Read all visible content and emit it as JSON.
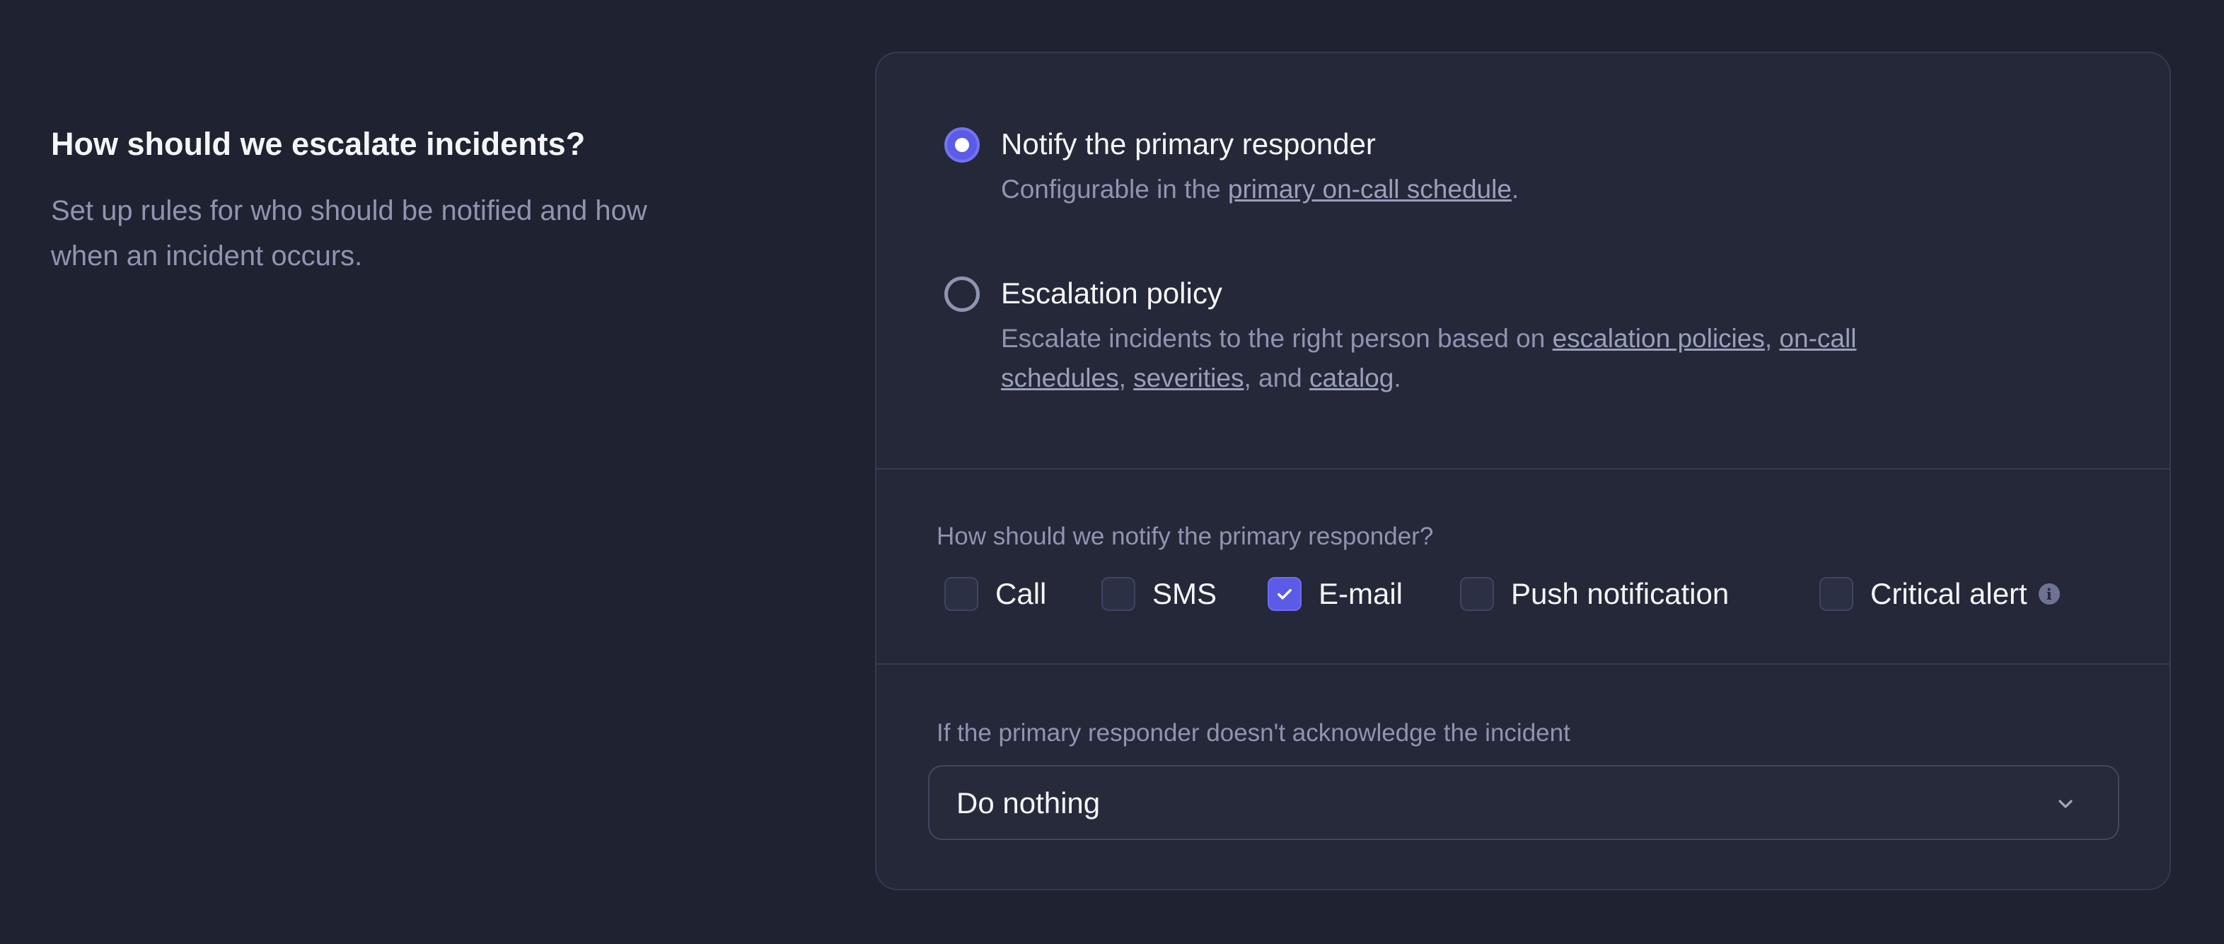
{
  "intro": {
    "title": "How should we escalate incidents?",
    "description": "Set up rules for who should be notified and how when an incident occurs."
  },
  "options": {
    "primary": {
      "title": "Notify the primary responder",
      "selected": true,
      "desc_prefix": "Configurable in the ",
      "link": "primary on-call schedule",
      "desc_suffix": "."
    },
    "escalation": {
      "title": "Escalation policy",
      "selected": false,
      "desc_prefix": "Escalate incidents to the right person based on ",
      "link1": "escalation policies",
      "sep1": ", ",
      "link2": "on-call schedules",
      "sep2": ", ",
      "link3": "severities",
      "sep3": ", and ",
      "link4": "catalog",
      "desc_suffix": "."
    }
  },
  "notify": {
    "label": "How should we notify the primary responder?",
    "methods": [
      {
        "label": "Call",
        "checked": false
      },
      {
        "label": "SMS",
        "checked": false
      },
      {
        "label": "E-mail",
        "checked": true
      },
      {
        "label": "Push notification",
        "checked": false
      },
      {
        "label": "Critical alert",
        "checked": false
      }
    ],
    "info_glyph": "i"
  },
  "no_ack": {
    "label": "If the primary responder doesn't acknowledge the incident",
    "selected_value": "Do nothing"
  },
  "colors": {
    "background": "#1f2231",
    "card": "#242839",
    "accent": "#5b5be8",
    "muted_text": "#8f95b0"
  },
  "icons": {
    "check": "check-icon",
    "chevron": "chevron-down-icon",
    "info": "info-icon"
  }
}
